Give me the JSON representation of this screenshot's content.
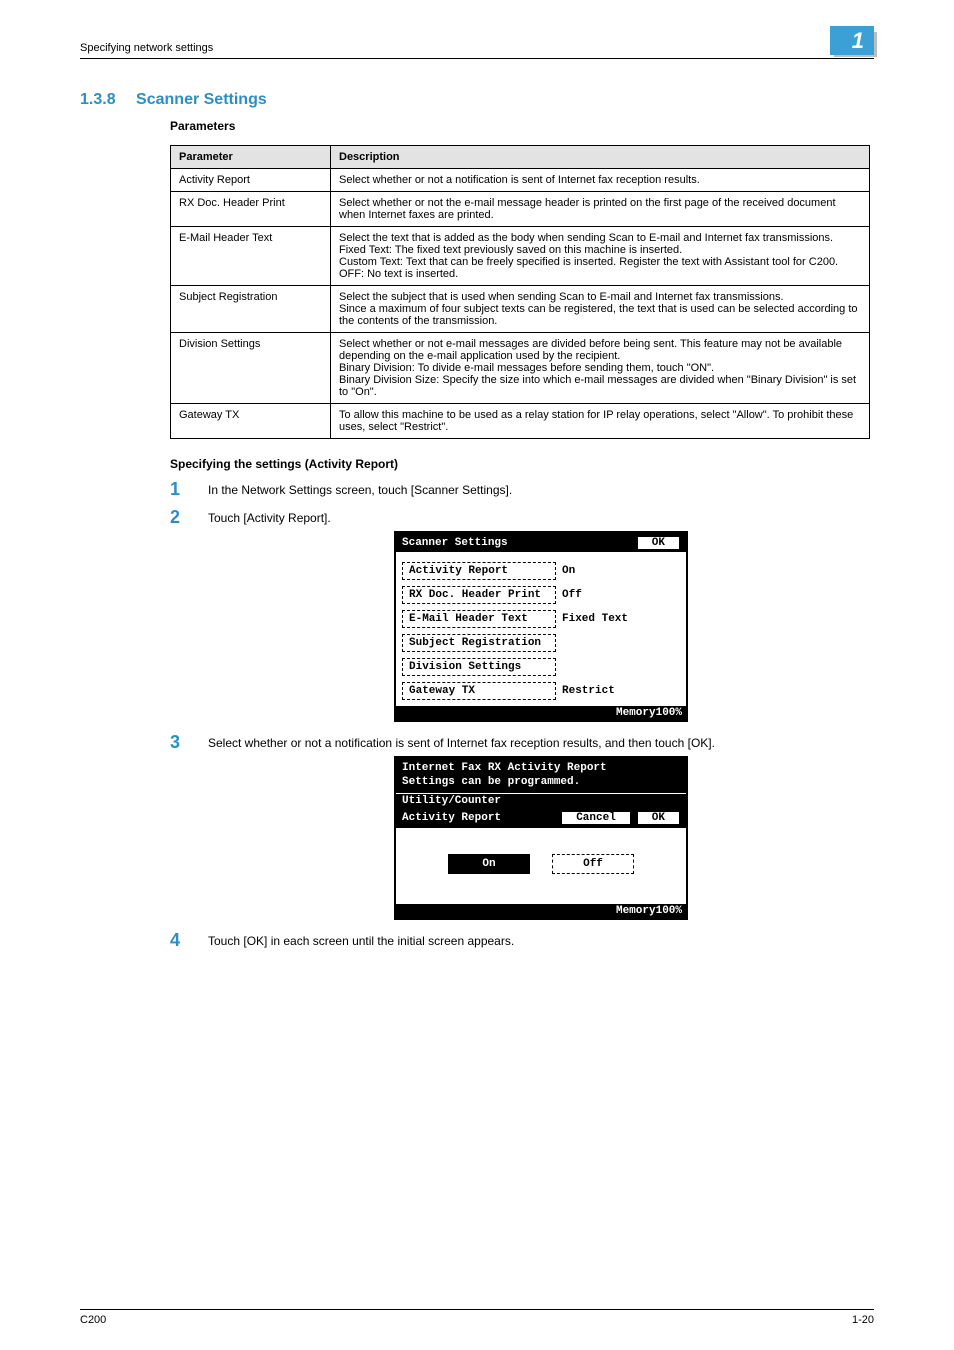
{
  "header": {
    "running_head": "Specifying network settings",
    "chapter_number": "1"
  },
  "section": {
    "number": "1.3.8",
    "title": "Scanner Settings",
    "parameters_heading": "Parameters",
    "table_headers": {
      "param": "Parameter",
      "desc": "Description"
    },
    "rows": [
      {
        "param": "Activity Report",
        "desc": "Select whether or not a notification is sent of Internet fax reception results."
      },
      {
        "param": "RX Doc. Header Print",
        "desc": "Select whether or not the e-mail message header is printed on the first page of the received document when Internet faxes are printed."
      },
      {
        "param": "E-Mail Header Text",
        "desc": "Select the text that is added as the body when sending Scan to E-mail and Internet fax transmissions.\nFixed Text: The fixed text previously saved on this machine is inserted.\nCustom Text: Text that can be freely specified is inserted. Register the text with Assistant tool for C200.\nOFF: No text is inserted."
      },
      {
        "param": "Subject Registration",
        "desc": "Select the subject that is used when sending Scan to E-mail and Internet fax transmissions.\nSince a maximum of four subject texts can be registered, the text that is used can be selected according to the contents of the transmission."
      },
      {
        "param": "Division Settings",
        "desc": "Select whether or not e-mail messages are divided before being sent. This feature may not be available depending on the e-mail application used by the recipient.\nBinary Division: To divide e-mail messages before sending them, touch \"ON\".\nBinary Division Size: Specify the size into which e-mail messages are divided when \"Binary Division\" is set to \"On\"."
      },
      {
        "param": "Gateway TX",
        "desc": "To allow this machine to be used as a relay station for IP relay operations, select \"Allow\". To prohibit these uses, select \"Restrict\"."
      }
    ],
    "subhead2": "Specifying the settings (Activity Report)",
    "steps": {
      "s1": "In the Network Settings screen, touch [Scanner Settings].",
      "s2": "Touch [Activity Report].",
      "s3": "Select whether or not a notification is sent of Internet fax reception results, and then touch [OK].",
      "s4": "Touch [OK] in each screen until the initial screen appears."
    }
  },
  "screenshot1": {
    "title": "Scanner Settings",
    "ok": "OK",
    "rows": [
      {
        "label": "Activity Report",
        "value": "On"
      },
      {
        "label": "RX Doc. Header Print",
        "value": "Off"
      },
      {
        "label": "E-Mail Header Text",
        "value": "Fixed Text"
      },
      {
        "label": "Subject Registration",
        "value": ""
      },
      {
        "label": "Division Settings",
        "value": ""
      },
      {
        "label": "Gateway TX",
        "value": "Restrict"
      }
    ],
    "memory": "Memory100%"
  },
  "screenshot2": {
    "msg_line1": "Internet Fax RX Activity Report",
    "msg_line2": "Settings can be programmed.",
    "utility": "Utility/Counter",
    "bar_label": "Activity Report",
    "cancel": "Cancel",
    "ok": "OK",
    "on": "On",
    "off": "Off",
    "memory": "Memory100%"
  },
  "footer": {
    "left": "C200",
    "right": "1-20"
  }
}
